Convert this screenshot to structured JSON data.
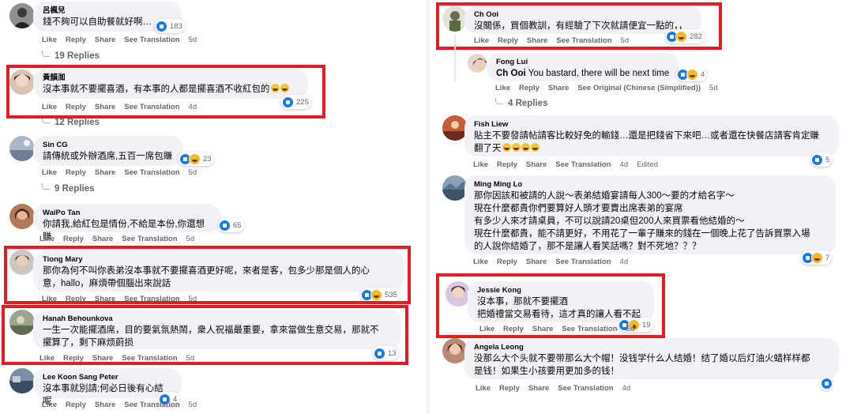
{
  "accent": "#e41b23",
  "left": [
    {
      "id": "c1",
      "author": "呂楓兒",
      "text": "錢不夠可以自助餐就好啊…",
      "reacts": [
        "like"
      ],
      "count": "183",
      "actions": [
        "Like",
        "Reply",
        "Share",
        "See Translation"
      ],
      "time": "5d",
      "replies": "19 Replies"
    },
    {
      "id": "c2",
      "author": "黃韻洳",
      "text": "沒本事就不要擺喜酒，有本事的人都是擺喜酒不收紅包的",
      "emoji": 2,
      "reacts": [
        "like"
      ],
      "count": "225",
      "actions": [
        "Like",
        "Reply",
        "Share",
        "See Translation"
      ],
      "time": "4d",
      "replies": "12 Replies"
    },
    {
      "id": "c3",
      "author": "Sin CG",
      "text": "請傳統或外辦酒席,五百一席包賺",
      "reacts": [
        "like",
        "haha"
      ],
      "count": "23",
      "actions": [
        "Like",
        "Reply",
        "Share",
        "See Translation"
      ],
      "time": "5d",
      "replies": "9 Replies"
    },
    {
      "id": "c4",
      "author": "WaiPo Tan",
      "text": "你請我,給紅包是情份,不給是本份,你還想賺",
      "reacts": [
        "like"
      ],
      "count": "65",
      "actions": [
        "Like",
        "Reply",
        "Share",
        "See Translation"
      ],
      "time": "5d"
    },
    {
      "id": "c5",
      "author": "Tiong Mary",
      "text": "那你為何不叫你表弟沒本事就不要擺喜酒更好呢，來者是客，包多少那是個人的心\n意，hallo，麻煩帶個腦出來說話",
      "reacts": [
        "like",
        "haha"
      ],
      "count": "535",
      "actions": [
        "Like",
        "Reply",
        "Share",
        "See Translation"
      ],
      "time": "5d"
    },
    {
      "id": "c6",
      "author": "Hanah Behounkova",
      "text": "一生一次能擺酒席，目的要氣氛熱鬧，衆人祝福最重要，拿來當做生意交易，那就不\n擺算了，剩下麻烦蔚损",
      "reacts": [
        "like"
      ],
      "count": "13",
      "actions": [
        "Like",
        "Reply",
        "Share",
        "See Translation"
      ],
      "time": "5d"
    },
    {
      "id": "c7",
      "author": "Lee Koon Sang Peter",
      "text": "沒本事就別請;何必日後有心結呢",
      "reacts": [
        "like"
      ],
      "count": "4",
      "actions": [
        "Like",
        "Reply",
        "Share",
        "See Translation"
      ],
      "time": "5d"
    }
  ],
  "right": [
    {
      "id": "r1",
      "author": "Ch Ooi",
      "text": "沒關係，買個教訓，有經驗了下次就請便宜一點的，，",
      "reacts": [
        "like",
        "haha"
      ],
      "count": "282",
      "actions": [
        "Like",
        "Reply",
        "Share",
        "See Translation"
      ],
      "time": "5d"
    },
    {
      "id": "r1a",
      "author": "Fong Lui",
      "tag": "Ch Ooi",
      "text": "You bastard, there will be next time",
      "reacts": [
        "like",
        "haha"
      ],
      "count": "4",
      "actions": [
        "Like",
        "Reply",
        "Share",
        "See Original (Chinese (Simplified))"
      ],
      "time": "5d",
      "replies": "4 Replies"
    },
    {
      "id": "r2",
      "author": "Fish Liew",
      "text": "貼主不要發請帖請客比較好免的輸錢…還是把錢省下來吧…或者還在快餐店請客肯定賺\n翻了天",
      "emoji": 4,
      "reacts": [
        "like"
      ],
      "count": "5",
      "actions": [
        "Like",
        "Reply",
        "Share",
        "See Translation"
      ],
      "time": "4d",
      "edited": "Edited"
    },
    {
      "id": "r3",
      "author": "Ming Ming Lo",
      "text": "那你因該和被請的人說～表弟結婚宴請每人300～要的才給名字～\n現在什麼都貴你們要算好人頭才要賣出席表弟的宴席\n有多少人來才請桌員，不可以說請20桌但200人來買票看他結婚的～\n現在什麼都貴，能不請更好，不用花了一輩子賺來的錢在一個晚上花了告訴買票入場\n的人說你結婚了，那不是讓人看笑話嗎？對不死地？？？",
      "reacts": [
        "like",
        "haha"
      ],
      "count": "7",
      "actions": [
        "Like",
        "Reply",
        "Share",
        "See Translation"
      ],
      "time": "4d"
    },
    {
      "id": "r4",
      "author": "Jessie Kong",
      "text": "沒本事，那就不要擺酒\n把婚禮當交易看待，這才真的讓人看不起",
      "reacts": [
        "like",
        "wow"
      ],
      "count": "19",
      "actions": [
        "Like",
        "Reply",
        "Share",
        "See Translation"
      ],
      "time": "5d"
    },
    {
      "id": "r5",
      "author": "Angela Leong",
      "text": "没那么大个头就不要带那么大个帽！没钱学什么人结婚！结了婚以后灯油火蜡样样都\n是钱！如果生小孩要用更加多的钱！",
      "reacts": [
        "like"
      ],
      "count": "",
      "actions": [
        "Like",
        "Reply",
        "Share",
        "See Translation"
      ],
      "time": "4d"
    }
  ]
}
